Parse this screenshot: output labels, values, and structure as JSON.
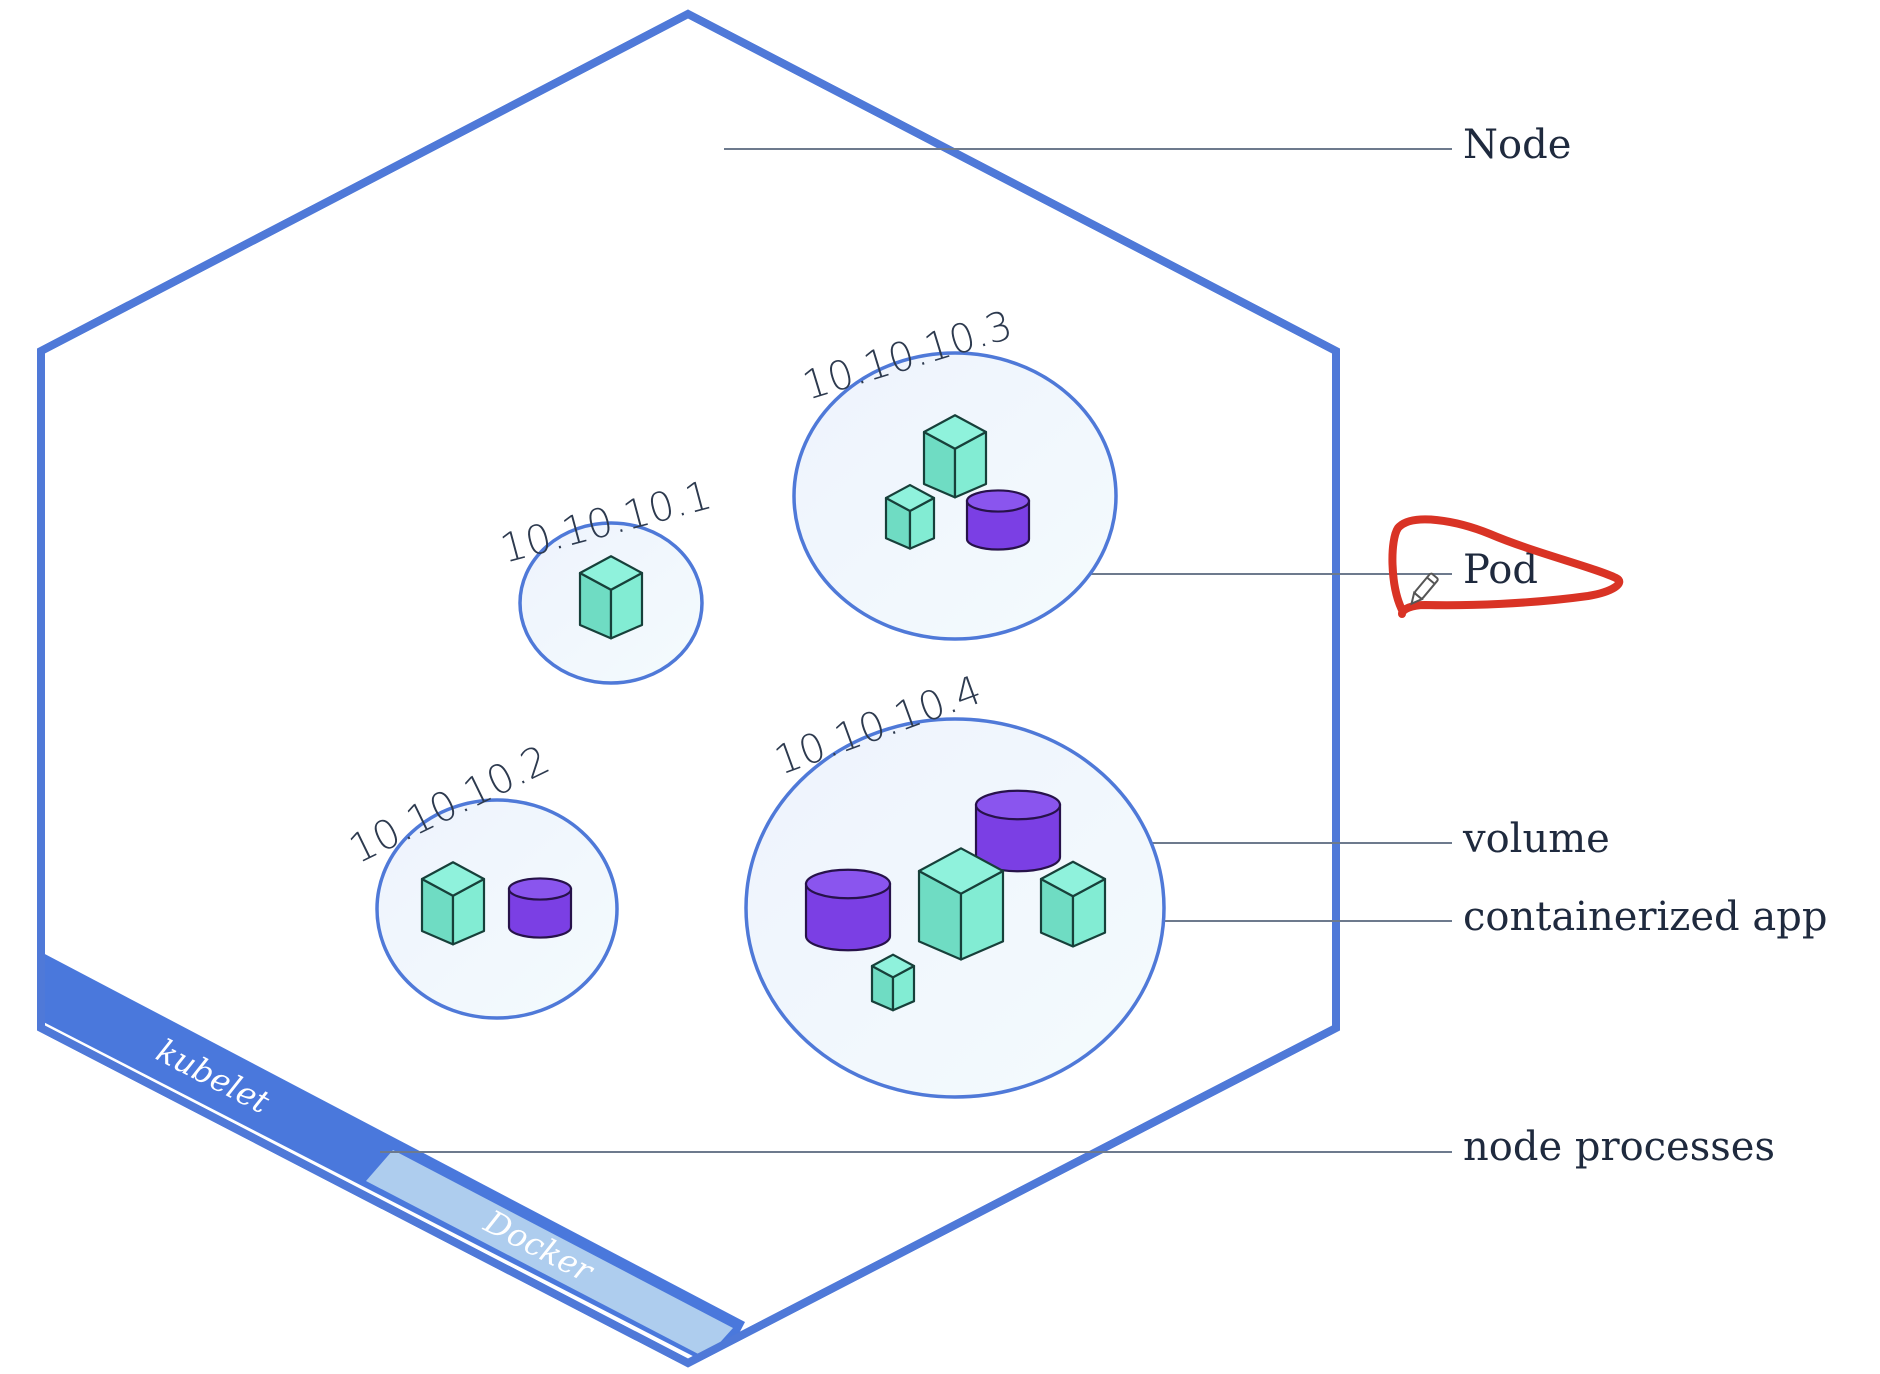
{
  "labels": {
    "node": "Node",
    "pod": "Pod",
    "volume": "volume",
    "containerized_app": "containerized app",
    "node_processes": "node processes"
  },
  "processes": {
    "kubelet": "kubelet",
    "docker": "Docker"
  },
  "pods": [
    {
      "ip": "10.10.10.1"
    },
    {
      "ip": "10.10.10.2"
    },
    {
      "ip": "10.10.10.3"
    },
    {
      "ip": "10.10.10.4"
    }
  ],
  "colors": {
    "node_border": "#4f79d8",
    "kubelet_band": "#4a78dc",
    "docker_band": "#aecdee",
    "container": "#76e5cc",
    "volume": "#7b3fe4",
    "annotation": "#d93325",
    "text": "#1f2a3e"
  },
  "icons": [
    "container-icon",
    "volume-icon",
    "pencil-cursor-icon"
  ]
}
